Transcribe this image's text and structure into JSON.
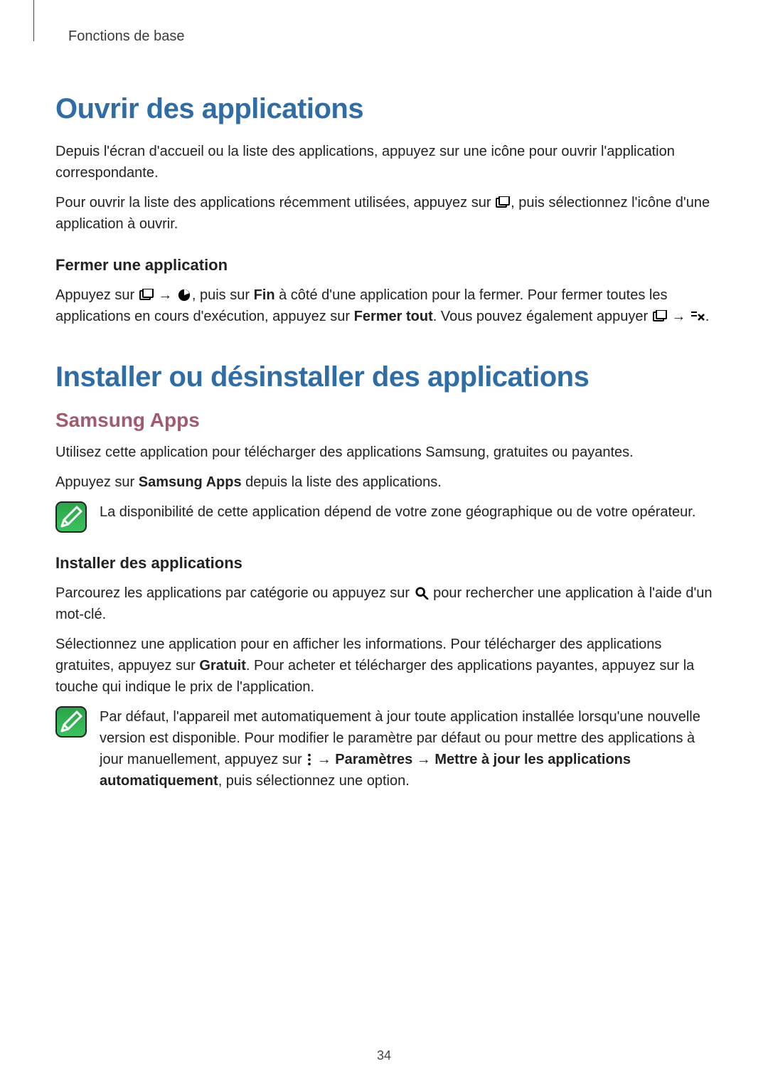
{
  "breadcrumb": "Fonctions de base",
  "page_number": "34",
  "s1": {
    "h1": "Ouvrir des applications",
    "p1": "Depuis l'écran d'accueil ou la liste des applications, appuyez sur une icône pour ouvrir l'application correspondante.",
    "p2a": "Pour ouvrir la liste des applications récemment utilisées, appuyez sur ",
    "p2b": ", puis sélectionnez l'icône d'une application à ouvrir.",
    "sub1": {
      "h3": "Fermer une application",
      "p1a": "Appuyez sur ",
      "p1b": " → ",
      "p1c": ", puis sur ",
      "p1c_bold": "Fin",
      "p1d": " à côté d'une application pour la fermer. Pour fermer toutes les applications en cours d'exécution, appuyez sur ",
      "p1d_bold": "Fermer tout",
      "p1e": ". Vous pouvez également appuyer ",
      "p1f": " → ",
      "p1g": "."
    }
  },
  "s2": {
    "h1": "Installer ou désinstaller des applications",
    "sub1": {
      "h2": "Samsung Apps",
      "p1": "Utilisez cette application pour télécharger des applications Samsung, gratuites ou payantes.",
      "p2a": "Appuyez sur ",
      "p2a_bold": "Samsung Apps",
      "p2b": " depuis la liste des applications.",
      "note": "La disponibilité de cette application dépend de votre zone géographique ou de votre opérateur."
    },
    "sub2": {
      "h3": "Installer des applications",
      "p1a": "Parcourez les applications par catégorie ou appuyez sur ",
      "p1b": " pour rechercher une application à l'aide d'un mot-clé.",
      "p2a": "Sélectionnez une application pour en afficher les informations. Pour télécharger des applications gratuites, appuyez sur ",
      "p2a_bold": "Gratuit",
      "p2b": ". Pour acheter et télécharger des applications payantes, appuyez sur la touche qui indique le prix de l'application.",
      "note_a": "Par défaut, l'appareil met automatiquement à jour toute application installée lorsqu'une nouvelle version est disponible. Pour modifier le paramètre par défaut ou pour mettre des applications à jour manuellement, appuyez sur ",
      "note_b": " → ",
      "note_b_bold1": "Paramètres",
      "note_c": " → ",
      "note_c_bold": "Mettre à jour les applications automatiquement",
      "note_d": ", puis sélectionnez une option."
    }
  }
}
